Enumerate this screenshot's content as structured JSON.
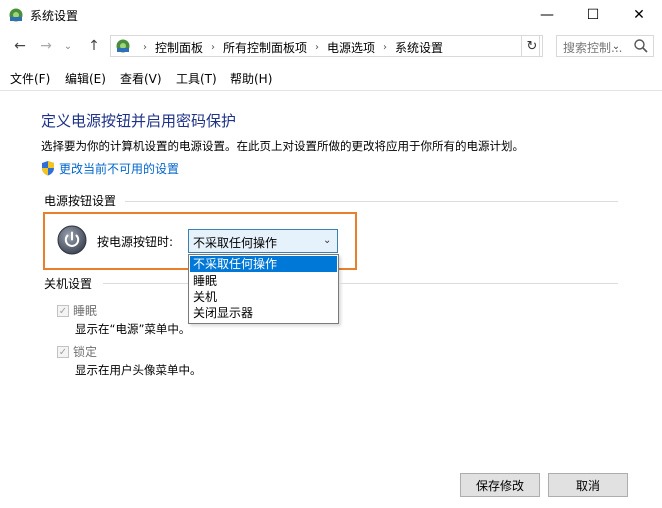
{
  "window": {
    "title": "系统设置",
    "minimize_glyph": "—",
    "maximize_glyph": "☐",
    "close_glyph": "✕"
  },
  "nav": {
    "back_glyph": "←",
    "forward_glyph": "→",
    "recent_glyph": "⌄",
    "up_glyph": "↑",
    "breadcrumbs": [
      "控制面板",
      "所有控制面板项",
      "电源选项",
      "系统设置"
    ],
    "separator": "›",
    "dropdown_glyph": "⌄",
    "refresh_glyph": "↻",
    "search_placeholder": "搜索控制..."
  },
  "menu": [
    "文件(F)",
    "编辑(E)",
    "查看(V)",
    "工具(T)",
    "帮助(H)"
  ],
  "content": {
    "heading": "定义电源按钮并启用密码保护",
    "description": "选择要为你的计算机设置的电源设置。在此页上对设置所做的更改将应用于你所有的电源计划。",
    "change_link": "更改当前不可用的设置",
    "power_section_title": "电源按钮设置",
    "power_button_label": "按电源按钮时:",
    "select_value": "不采取任何操作",
    "dropdown_options": [
      "不采取任何操作",
      "睡眠",
      "关机",
      "关闭显示器"
    ],
    "shutdown_section_title": "关机设置",
    "sleep_label": "睡眠",
    "sleep_desc": "显示在“电源”菜单中。",
    "lock_label": "锁定",
    "lock_desc": "显示在用户头像菜单中。"
  },
  "footer": {
    "save_label": "保存修改",
    "cancel_label": "取消"
  },
  "colors": {
    "heading": "#1e3287",
    "link": "#0066cc",
    "highlight_border": "#e77f2f",
    "selected_option": "#0078d7"
  }
}
